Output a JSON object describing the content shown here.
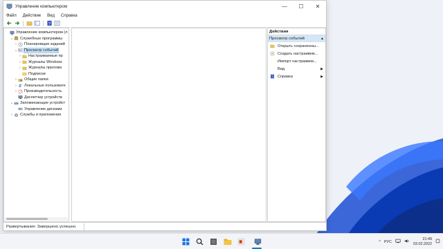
{
  "window": {
    "title": "Управление компьютером",
    "controls": {
      "minimize": "—",
      "maximize": "☐",
      "close": "✕"
    }
  },
  "menu": [
    "Файл",
    "Действие",
    "Вид",
    "Справка"
  ],
  "toolbar": [
    "back-icon",
    "forward-icon",
    "folder-up-icon",
    "show-hide-tree-icon",
    "help-icon",
    "properties-icon"
  ],
  "tree": [
    {
      "label": "Управление компьютером (л",
      "chev": "",
      "indent": 0,
      "icon": "computer-management-icon"
    },
    {
      "label": "Служебные программы",
      "chev": "⌄",
      "indent": 1,
      "icon": "tools-icon"
    },
    {
      "label": "Планировщик заданий",
      "chev": "›",
      "indent": 2,
      "icon": "clock-icon"
    },
    {
      "label": "Просмотр событий",
      "chev": "⌄",
      "indent": 2,
      "icon": "event-viewer-icon",
      "selected": true
    },
    {
      "label": "Настраиваемые пр",
      "chev": "›",
      "indent": 3,
      "icon": "folder-icon"
    },
    {
      "label": "Журналы Windows",
      "chev": "›",
      "indent": 3,
      "icon": "folder-icon"
    },
    {
      "label": "Журналы приложе",
      "chev": "›",
      "indent": 3,
      "icon": "folder-icon"
    },
    {
      "label": "Подписки",
      "chev": "",
      "indent": 3,
      "icon": "subscriptions-icon"
    },
    {
      "label": "Общие папки",
      "chev": "›",
      "indent": 2,
      "icon": "shared-folder-icon"
    },
    {
      "label": "Локальные пользовате",
      "chev": "›",
      "indent": 2,
      "icon": "users-icon"
    },
    {
      "label": "Производительность",
      "chev": "›",
      "indent": 2,
      "icon": "performance-icon"
    },
    {
      "label": "Диспетчер устройств",
      "chev": "",
      "indent": 2,
      "icon": "device-manager-icon"
    },
    {
      "label": "Запоминающие устройст",
      "chev": "⌄",
      "indent": 1,
      "icon": "storage-icon"
    },
    {
      "label": "Управление дисками",
      "chev": "",
      "indent": 2,
      "icon": "disk-icon"
    },
    {
      "label": "Службы и приложения",
      "chev": "›",
      "indent": 1,
      "icon": "services-icon"
    }
  ],
  "actions": {
    "header": "Действия",
    "group": "Просмотр событий",
    "items": [
      {
        "label": "Открыть сохраненны...",
        "icon": "open-folder-icon",
        "submenu": false
      },
      {
        "label": "Создать настраивем...",
        "icon": "create-view-icon",
        "submenu": false
      },
      {
        "label": "Импорт настраивем...",
        "icon": "",
        "submenu": false
      },
      {
        "label": "Вид",
        "icon": "",
        "submenu": true
      },
      {
        "label": "Справка",
        "icon": "help-icon",
        "submenu": true
      }
    ]
  },
  "status": {
    "text": "Развертывание:  Завершено успешно."
  },
  "taskbar": {
    "apps": [
      "start-icon",
      "search-icon",
      "file-explorer-icon",
      "folder-icon",
      "office-icon",
      "computer-management-icon"
    ],
    "tray": {
      "chevron": "^",
      "lang": "РУС",
      "time": "21:49",
      "date": "03.02.2022"
    }
  },
  "colors": {
    "accent": "#0078d4",
    "selection": "#cce4f7",
    "actions_group": "#d3e6f6"
  }
}
